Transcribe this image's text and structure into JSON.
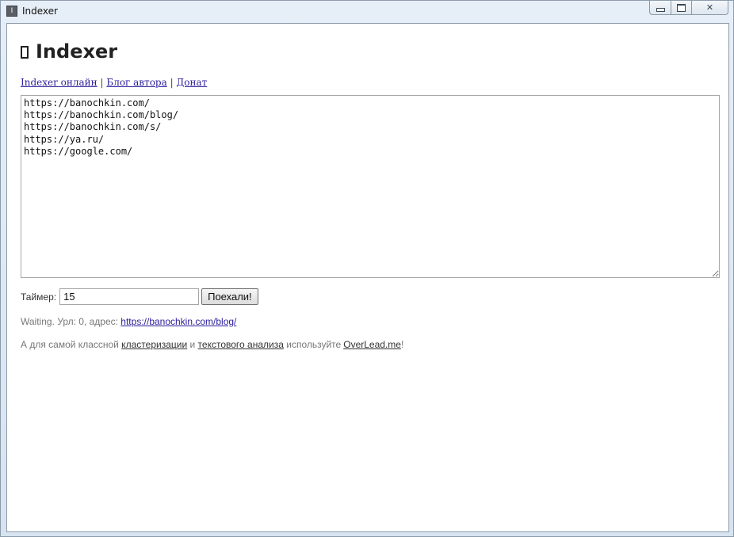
{
  "window": {
    "title": "Indexer",
    "app_icon_letter": "I",
    "min_icon": "minimize-icon",
    "max_icon": "maximize-icon",
    "close_icon": "close-icon",
    "close_glyph": "✕"
  },
  "header": {
    "icon": "box-icon",
    "title": "Indexer"
  },
  "links": {
    "online": "Indexer онлайн",
    "sep1": "|",
    "blog": "Блог автора",
    "sep2": "|",
    "donate": "Донат"
  },
  "urls_textarea": {
    "value": "https://banochkin.com/\nhttps://banochkin.com/blog/\nhttps://banochkin.com/s/\nhttps://ya.ru/\nhttps://google.com/"
  },
  "timer": {
    "label": "Таймер:",
    "value": "15",
    "button_label": "Поехали!"
  },
  "status": {
    "text": "Waiting. Урл: 0, адрес:",
    "link": "https://banochkin.com/blog/"
  },
  "footer": {
    "part1": "А для самой классной",
    "link1": "кластеризации",
    "part2": "и",
    "link2": "текстового анализа",
    "part3": "используйте",
    "link3": "OverLead.me",
    "part4": "!"
  },
  "colors": {
    "link": "#2a1e9c",
    "muted_text": "#777777",
    "heading": "#222222"
  }
}
